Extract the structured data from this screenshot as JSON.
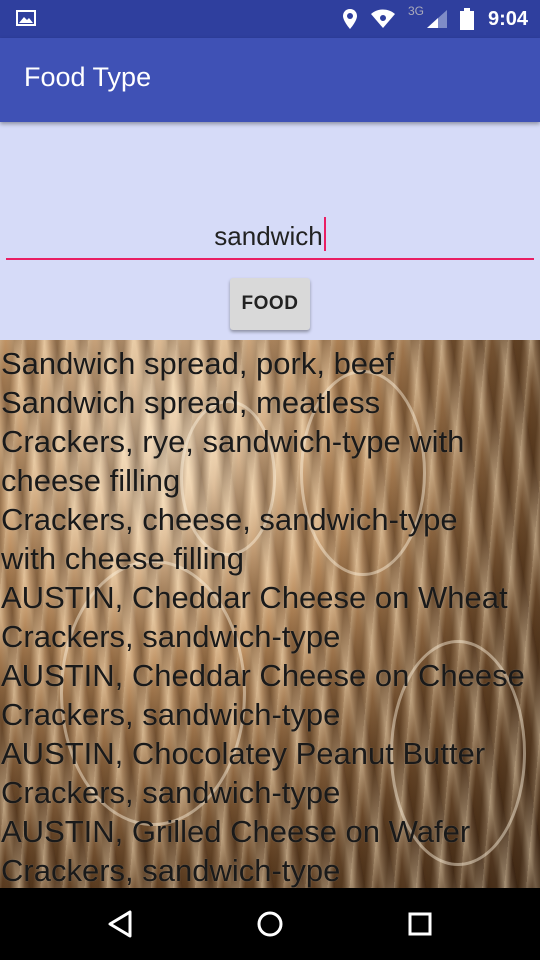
{
  "status_bar": {
    "time": "9:04",
    "network_label": "3G",
    "icons": [
      "image-icon",
      "location-icon",
      "wifi-icon",
      "signal-icon",
      "battery-icon"
    ]
  },
  "app_bar": {
    "title": "Food Type"
  },
  "search": {
    "value": "sandwich"
  },
  "food_button": {
    "label": "FOOD"
  },
  "results": {
    "lines": [
      "Sandwich spread, pork, beef",
      "Sandwich spread, meatless",
      "Crackers, rye, sandwich-type with",
      "cheese filling",
      "Crackers, cheese, sandwich-type",
      "with cheese filling",
      "AUSTIN, Cheddar Cheese on Wheat",
      "Crackers, sandwich-type",
      "AUSTIN, Cheddar Cheese on Cheese",
      "Crackers, sandwich-type",
      "AUSTIN, Chocolatey Peanut Butter",
      "Crackers, sandwich-type",
      "AUSTIN, Grilled Cheese on Wafer",
      "Crackers, sandwich-type"
    ]
  },
  "nav_bar": {
    "buttons": [
      "back-icon",
      "home-icon",
      "recents-icon"
    ]
  },
  "colors": {
    "status_bar": "#2f3f9e",
    "app_bar": "#3f51b5",
    "panel": "#d6dbf8",
    "accent": "#e91e63",
    "button": "#d9d9d9"
  }
}
